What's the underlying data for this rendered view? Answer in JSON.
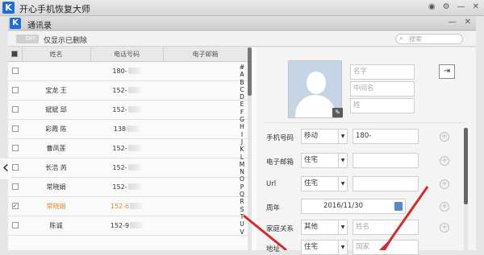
{
  "app": {
    "title": "开心手机恢复大师",
    "logo_letter": "K"
  },
  "window": {
    "title": "通讯录",
    "logo_letter": "K"
  },
  "filter": {
    "toggle_label": "OFF",
    "show_deleted_label": "仅显示已删除",
    "search_placeholder": "搜索"
  },
  "table": {
    "headers": [
      "",
      "姓名",
      "电话号码",
      "电子邮箱"
    ],
    "rows": [
      {
        "name": "",
        "phone": "180-",
        "checked": false,
        "selected": false
      },
      {
        "name": "宝龙 王",
        "phone": "152-",
        "checked": false,
        "selected": false
      },
      {
        "name": "斌斌 邱",
        "phone": "152-",
        "checked": false,
        "selected": false
      },
      {
        "name": "彩霞 陈",
        "phone": "138",
        "checked": false,
        "selected": false
      },
      {
        "name": "曹凤莲",
        "phone": "152-",
        "checked": false,
        "selected": false
      },
      {
        "name": "长浩 芮",
        "phone": "152-",
        "checked": false,
        "selected": false
      },
      {
        "name": "常晓娟",
        "phone": "152-",
        "checked": false,
        "selected": false
      },
      {
        "name": "常晓娟",
        "phone": "152-6",
        "checked": true,
        "selected": true
      },
      {
        "name": "陈诚",
        "phone": "152-9",
        "checked": false,
        "selected": false
      }
    ]
  },
  "alphabet": [
    "#",
    "A",
    "B",
    "C",
    "D",
    "E",
    "F",
    "G",
    "H",
    "I",
    "J",
    "K",
    "L",
    "M",
    "N",
    "O",
    "P",
    "Q",
    "R",
    "S",
    "T",
    "U",
    "V"
  ],
  "detail": {
    "name_placeholders": {
      "first": "名字",
      "middle": "中间名",
      "last": "姓"
    },
    "phone": {
      "label": "手机号码",
      "type": "移动",
      "value": "180-"
    },
    "email": {
      "label": "电子邮箱",
      "type": "住宅"
    },
    "url": {
      "label": "Url",
      "type": "住宅"
    },
    "anniversary": {
      "label": "周年",
      "value": "2016/11/30"
    },
    "relation": {
      "label": "家庭关系",
      "type": "其他",
      "placeholder": "姓名"
    },
    "address": {
      "label": "地址",
      "type": "住宅",
      "placeholder": "国家"
    }
  },
  "colors": {
    "accent": "#1e6fd1",
    "selected_text": "#e58a2c",
    "arrow_red": "#d62a2a"
  }
}
